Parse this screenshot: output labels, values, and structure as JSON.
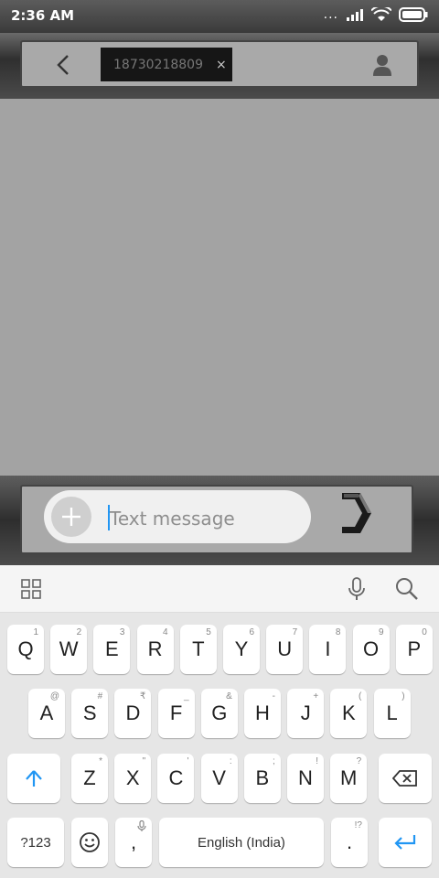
{
  "status_bar": {
    "time": "2:36 AM",
    "dots": "..."
  },
  "header": {
    "recipient": "18730218809",
    "remove_chip": "×"
  },
  "compose": {
    "placeholder": "Text message"
  },
  "keyboard": {
    "row1": [
      {
        "key": "Q",
        "hint": "1"
      },
      {
        "key": "W",
        "hint": "2"
      },
      {
        "key": "E",
        "hint": "3"
      },
      {
        "key": "R",
        "hint": "4"
      },
      {
        "key": "T",
        "hint": "5"
      },
      {
        "key": "Y",
        "hint": "6"
      },
      {
        "key": "U",
        "hint": "7"
      },
      {
        "key": "I",
        "hint": "8"
      },
      {
        "key": "O",
        "hint": "9"
      },
      {
        "key": "P",
        "hint": "0"
      }
    ],
    "row2": [
      {
        "key": "A",
        "hint": "@"
      },
      {
        "key": "S",
        "hint": "#"
      },
      {
        "key": "D",
        "hint": "₹"
      },
      {
        "key": "F",
        "hint": "_"
      },
      {
        "key": "G",
        "hint": "&"
      },
      {
        "key": "H",
        "hint": "-"
      },
      {
        "key": "J",
        "hint": "+"
      },
      {
        "key": "K",
        "hint": "("
      },
      {
        "key": "L",
        "hint": ")"
      }
    ],
    "row3": [
      {
        "key": "Z",
        "hint": "*"
      },
      {
        "key": "X",
        "hint": "\""
      },
      {
        "key": "C",
        "hint": "'"
      },
      {
        "key": "V",
        "hint": ":"
      },
      {
        "key": "B",
        "hint": ";"
      },
      {
        "key": "N",
        "hint": "!"
      },
      {
        "key": "M",
        "hint": "?"
      }
    ],
    "symbols_key": "?123",
    "comma_key": ",",
    "space_label": "English (India)",
    "period_key": ".",
    "period_hint": "!?"
  },
  "colors": {
    "accent": "#2196f3"
  }
}
